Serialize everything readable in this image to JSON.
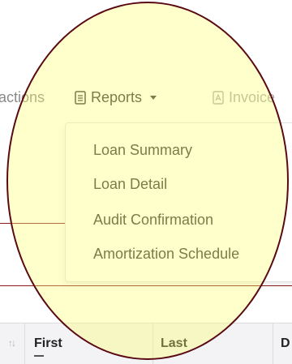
{
  "nav": {
    "transactions_label": "actions",
    "reports_label": "Reports",
    "invoice_label": "Invoice"
  },
  "reports_menu": {
    "items": [
      {
        "label": "Loan Summary"
      },
      {
        "label": "Loan Detail"
      },
      {
        "label": "Audit Confirmation"
      },
      {
        "label": "Amortization Schedule"
      }
    ]
  },
  "table": {
    "columns": [
      {
        "label": "First"
      },
      {
        "label": "Last"
      },
      {
        "label": "D"
      }
    ]
  },
  "colors": {
    "highlight_fill": "#ffff6e",
    "highlight_border": "#5a0a14",
    "annotation_line": "#8b1a1a"
  },
  "icons": {
    "reports": "document-list-icon",
    "invoice": "pdf-file-icon",
    "sort": "sort-arrows-icon"
  }
}
